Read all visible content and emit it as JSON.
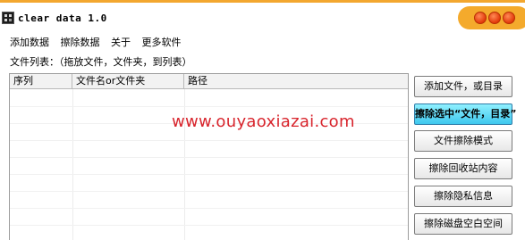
{
  "window": {
    "title": "clear data 1.0"
  },
  "menu": {
    "items": [
      "添加数据",
      "擦除数据",
      "关于",
      "更多软件"
    ]
  },
  "file_list": {
    "hint": "文件列表：（拖放文件，文件夹，到列表）",
    "columns": [
      "序列",
      "文件名or文件夹",
      "路径"
    ]
  },
  "watermark": "www.ouyaoxiazai.com",
  "buttons": {
    "add": "添加文件，或目录",
    "remove_selected": "擦除选中“文件，目录”",
    "erase_mode": "文件擦除模式",
    "erase_recycle": "擦除回收站内容",
    "erase_privacy": "擦除隐私信息",
    "erase_free_space": "擦除磁盘空白空间"
  },
  "colors": {
    "title_accent": "#f3a72f",
    "active_button": "#3ec8ee",
    "watermark": "#d8242c"
  }
}
